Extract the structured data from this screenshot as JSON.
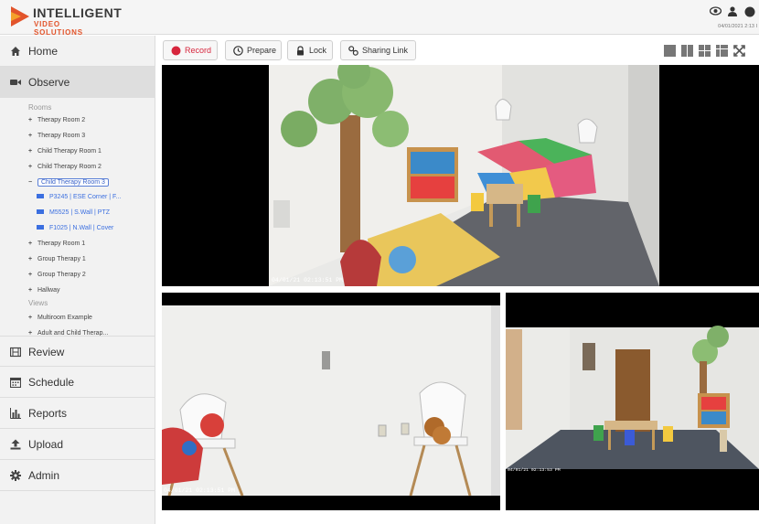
{
  "brand": {
    "name": "INTELLIGENT",
    "sub": "VIDEO SOLUTIONS"
  },
  "header": {
    "datetime": "04/01/2021 2:13 I",
    "icons": [
      "eye-icon",
      "user-icon",
      "help-icon"
    ]
  },
  "sidebar": {
    "nav": [
      {
        "label": "Home",
        "icon": "home-icon"
      },
      {
        "label": "Observe",
        "icon": "video-camera-icon"
      },
      {
        "label": "Review",
        "icon": "film-icon"
      },
      {
        "label": "Schedule",
        "icon": "calendar-icon"
      },
      {
        "label": "Reports",
        "icon": "bar-chart-icon"
      },
      {
        "label": "Upload",
        "icon": "upload-icon"
      },
      {
        "label": "Admin",
        "icon": "gear-icon"
      }
    ],
    "rooms_heading": "Rooms",
    "rooms": [
      "Therapy Room 2",
      "Therapy Room 3",
      "Child Therapy Room 1",
      "Child Therapy Room 2",
      "Child Therapy Room 3",
      "Therapy Room 1",
      "Group Therapy 1",
      "Group Therapy 2",
      "Hallway"
    ],
    "cameras": [
      "P3245 | ESE Corner | F...",
      "M5525 | S.Wall | PTZ",
      "F1025 | N.Wall | Cover"
    ],
    "views_heading": "Views",
    "views": [
      "Multiroom Example",
      "Adult and Child Therap..."
    ],
    "expand_symbol": "+",
    "collapse_symbol": "−"
  },
  "toolbar": {
    "record": "Record",
    "prepare": "Prepare",
    "lock": "Lock",
    "sharing": "Sharing Link",
    "layout_icons": [
      "single-layout-icon",
      "two-column-layout-icon",
      "quad-layout-icon",
      "nine-grid-layout-icon",
      "fullscreen-icon"
    ]
  },
  "feeds": [
    {
      "timestamp": "04/01/21 02:13:51 PM"
    },
    {
      "timestamp": "04/01/21 02:13:51 PM"
    },
    {
      "timestamp": "04/01/21 02:13:53 PM"
    }
  ],
  "colors": {
    "record_red": "#d7263d",
    "brand_orange": "#e2542b",
    "selected_blue": "#3b6fe0"
  }
}
